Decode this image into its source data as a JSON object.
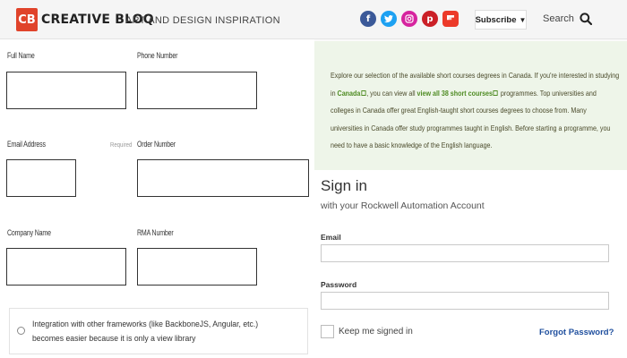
{
  "header": {
    "logo_badge": "CB",
    "logo_text": "CREATIVE BLOQ",
    "tagline": "ART AND DESIGN INSPIRATION",
    "social": [
      {
        "name": "facebook-icon",
        "glyph": "f"
      },
      {
        "name": "twitter-icon",
        "glyph": "t"
      },
      {
        "name": "instagram-icon",
        "glyph": "◎"
      },
      {
        "name": "pinterest-icon",
        "glyph": "p"
      },
      {
        "name": "flipboard-icon",
        "glyph": "f"
      }
    ],
    "subscribe_label": "Subscribe",
    "subscribe_caret": "▼",
    "search_label": "Search"
  },
  "form": {
    "full_name_label": "Full Name",
    "phone_label": "Phone Number",
    "email_label": "Email Address",
    "required_label": "Required",
    "order_label": "Order Number",
    "company_label": "Company Name",
    "rma_label": "RMA Number",
    "radio_text": "Integration with other frameworks (like BackboneJS, Angular, etc.) becomes easier because it is only a view library"
  },
  "info": {
    "text_1": "Explore our selection of the available short courses degrees in Canada. If you're interested in studying in ",
    "link_canada": "Canada",
    "text_2": ", you can view all ",
    "link_all": "view all 38 short courses",
    "text_3": " programmes. Top universities and colleges in Canada offer great English-taught short courses degrees to choose from. Many universities in Canada offer study programmes taught in English. Before starting a programme, you need to have a basic knowledge of the English language."
  },
  "signin": {
    "title": "Sign in",
    "subtitle": "with your Rockwell Automation Account",
    "email_label": "Email",
    "password_label": "Password",
    "keep_label": "Keep me signed in",
    "forgot_label": "Forgot Password?"
  },
  "colors": {
    "brand_red": "#e0432a",
    "info_bg": "#eef5e9",
    "link_green": "#4e8b22",
    "forgot_blue": "#1f4f9e"
  }
}
